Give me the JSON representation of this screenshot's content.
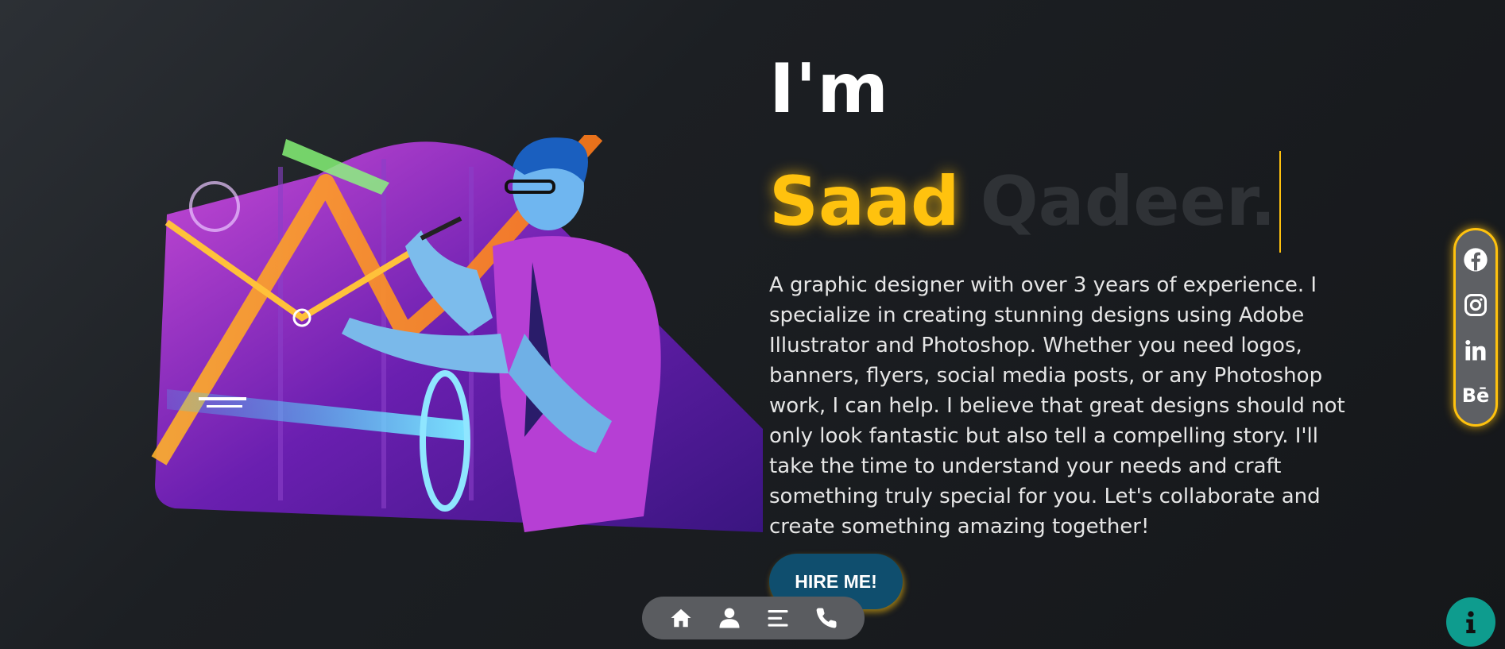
{
  "hero": {
    "greeting": "I'm",
    "name_first": "Saad",
    "name_last": "Qadeer.",
    "bio": "A graphic designer with over 3 years of experience. I specialize in creating stunning designs using Adobe Illustrator and Photoshop. Whether you need logos, banners, flyers, social media posts, or any Photoshop work, I can help. I believe that great designs should not only look fantastic but also tell a compelling story. I'll take the time to understand your needs and craft something truly special for you. Let's collaborate and create something amazing together!",
    "cta_label": "HIRE ME!"
  },
  "bottom_nav": [
    {
      "icon": "home-icon"
    },
    {
      "icon": "user-icon"
    },
    {
      "icon": "menu-icon"
    },
    {
      "icon": "phone-icon"
    }
  ],
  "social": {
    "items": [
      {
        "icon": "facebook-icon"
      },
      {
        "icon": "instagram-icon"
      },
      {
        "icon": "linkedin-icon"
      },
      {
        "icon": "behance-icon",
        "text": "Bē"
      }
    ]
  },
  "colors": {
    "accent": "#ffc20e",
    "button": "#0f4e6e",
    "info": "#0e9c8e",
    "muted_name": "#2f3236"
  }
}
